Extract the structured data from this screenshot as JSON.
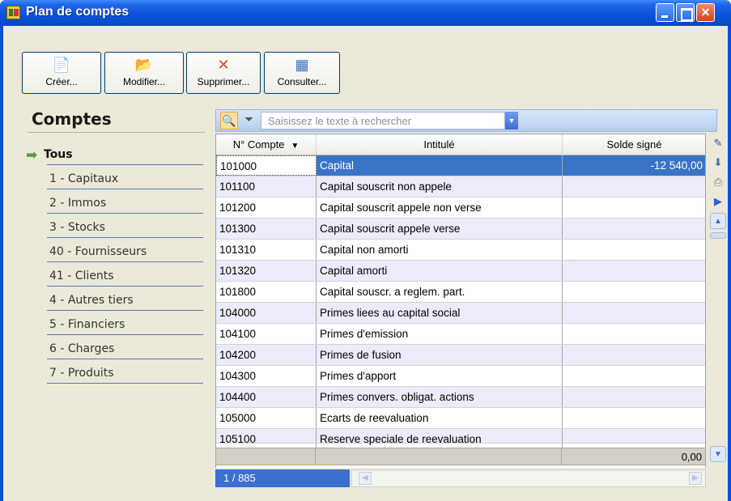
{
  "window": {
    "title": "Plan de comptes"
  },
  "toolbar": {
    "create_label": "Créer...",
    "modify_label": "Modifier...",
    "delete_label": "Supprimer...",
    "consult_label": "Consulter..."
  },
  "left": {
    "title": "Comptes",
    "items": [
      {
        "label": "Tous"
      },
      {
        "label": "1 - Capitaux"
      },
      {
        "label": "2 - Immos"
      },
      {
        "label": "3 - Stocks"
      },
      {
        "label": "40 - Fournisseurs"
      },
      {
        "label": "41 - Clients"
      },
      {
        "label": "4 - Autres tiers"
      },
      {
        "label": "5 - Financiers"
      },
      {
        "label": "6 - Charges"
      },
      {
        "label": "7 - Produits"
      }
    ]
  },
  "search": {
    "placeholder": "Saisissez le texte à rechercher"
  },
  "grid": {
    "headers": {
      "num": "N° Compte",
      "intitule": "Intitulé",
      "solde": "Solde signé"
    },
    "rows": [
      {
        "num": "101000",
        "intitule": "Capital",
        "solde": "-12 540,00"
      },
      {
        "num": "101100",
        "intitule": "Capital souscrit non appele",
        "solde": ""
      },
      {
        "num": "101200",
        "intitule": "Capital souscrit appele non verse",
        "solde": ""
      },
      {
        "num": "101300",
        "intitule": "Capital souscrit appele verse",
        "solde": ""
      },
      {
        "num": "101310",
        "intitule": "Capital non amorti",
        "solde": ""
      },
      {
        "num": "101320",
        "intitule": "Capital amorti",
        "solde": ""
      },
      {
        "num": "101800",
        "intitule": "Capital souscr. a reglem. part.",
        "solde": ""
      },
      {
        "num": "104000",
        "intitule": "Primes liees au capital social",
        "solde": ""
      },
      {
        "num": "104100",
        "intitule": "Primes d'emission",
        "solde": ""
      },
      {
        "num": "104200",
        "intitule": "Primes de fusion",
        "solde": ""
      },
      {
        "num": "104300",
        "intitule": "Primes d'apport",
        "solde": ""
      },
      {
        "num": "104400",
        "intitule": "Primes convers. obligat. actions",
        "solde": ""
      },
      {
        "num": "105000",
        "intitule": "Ecarts de reevaluation",
        "solde": ""
      },
      {
        "num": "105100",
        "intitule": "Reserve speciale de reevaluation",
        "solde": ""
      }
    ],
    "total": "0,00"
  },
  "status": {
    "count": "1 / 885"
  }
}
